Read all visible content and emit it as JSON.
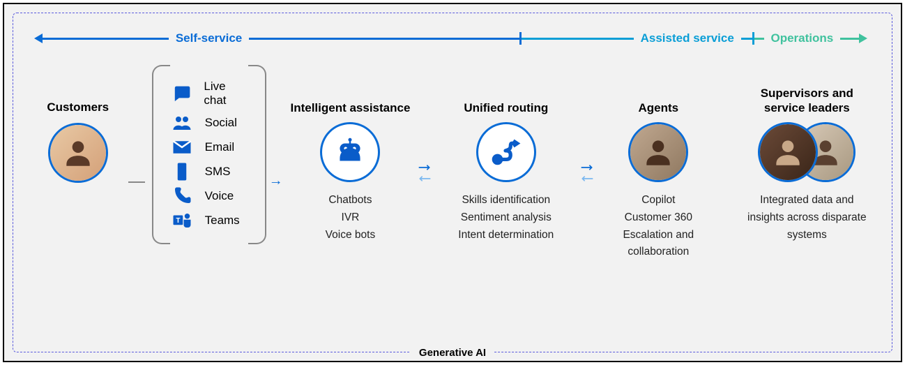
{
  "timeline": {
    "self_service": "Self-service",
    "assisted_service": "Assisted service",
    "operations": "Operations"
  },
  "customers": {
    "title": "Customers"
  },
  "channels": [
    {
      "icon": "chat",
      "label": "Live chat"
    },
    {
      "icon": "social",
      "label": "Social"
    },
    {
      "icon": "email",
      "label": "Email"
    },
    {
      "icon": "sms",
      "label": "SMS"
    },
    {
      "icon": "voice",
      "label": "Voice"
    },
    {
      "icon": "teams",
      "label": "Teams"
    }
  ],
  "intelligent": {
    "title": "Intelligent assistance",
    "items": [
      "Chatbots",
      "IVR",
      "Voice bots"
    ]
  },
  "routing": {
    "title": "Unified routing",
    "items": [
      "Skills identification",
      "Sentiment analysis",
      "Intent determination"
    ]
  },
  "agents": {
    "title": "Agents",
    "items": [
      "Copilot",
      "Customer 360",
      "Escalation and collaboration"
    ]
  },
  "supervisors": {
    "title": "Supervisors and service leaders",
    "description": "Integrated data and insights across disparate systems"
  },
  "footer": "Generative AI"
}
